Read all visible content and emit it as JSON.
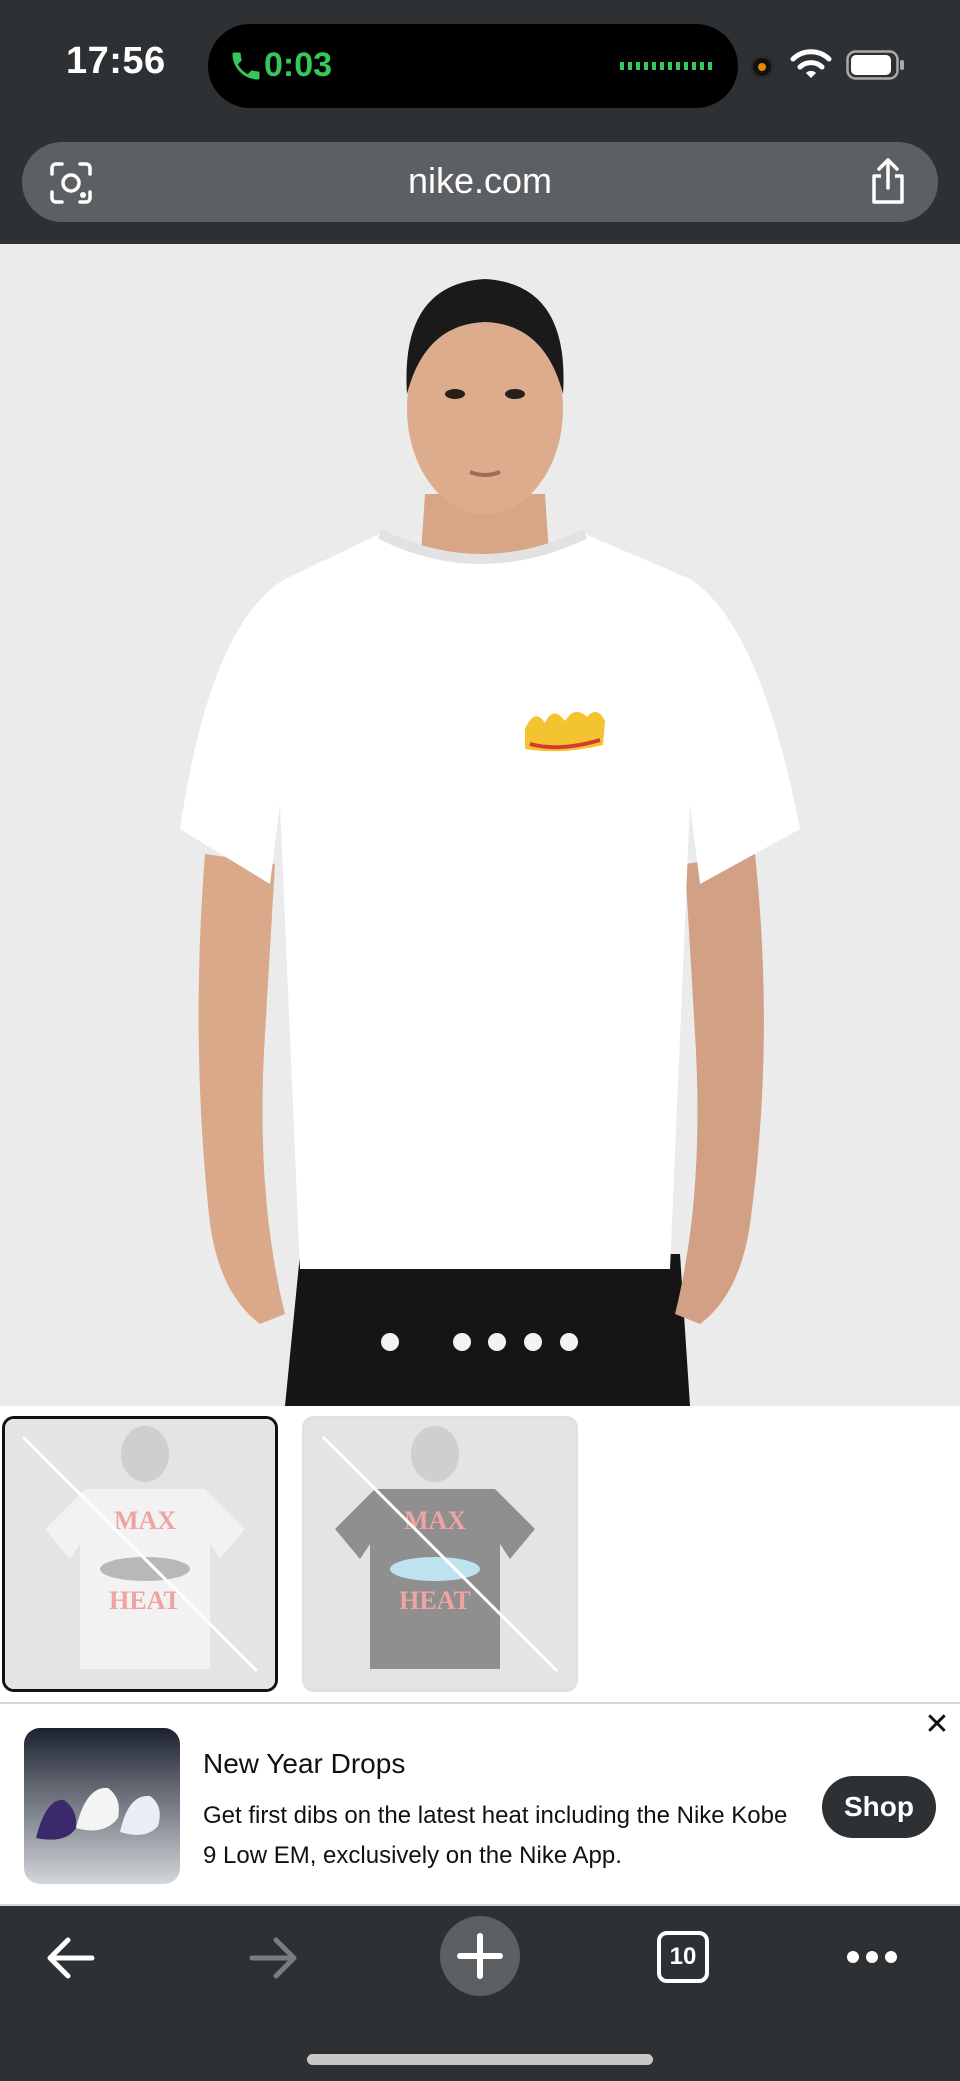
{
  "status_bar": {
    "time": "17:56",
    "call_duration": "0:03"
  },
  "browser": {
    "url": "nike.com"
  },
  "product_gallery": {
    "page_dots": 5,
    "active_dot": 1,
    "thumbnails": [
      {
        "name": "back-white-tee",
        "print_text": "MAX HEAT",
        "selected": true
      },
      {
        "name": "back-black-tee",
        "print_text": "MAX HEAT",
        "selected": false
      }
    ]
  },
  "promo": {
    "title": "New Year Drops",
    "body": "Get first dibs on the latest heat including the Nike Kobe 9 Low EM, exclusively on the Nike App.",
    "button": "Shop",
    "close": "✕"
  },
  "toolbar": {
    "tab_count": "10"
  },
  "colors": {
    "chrome": "#2d3133",
    "url_pill": "#5d6063",
    "call_green": "#34c759",
    "hero_bg": "#ebebeb"
  }
}
